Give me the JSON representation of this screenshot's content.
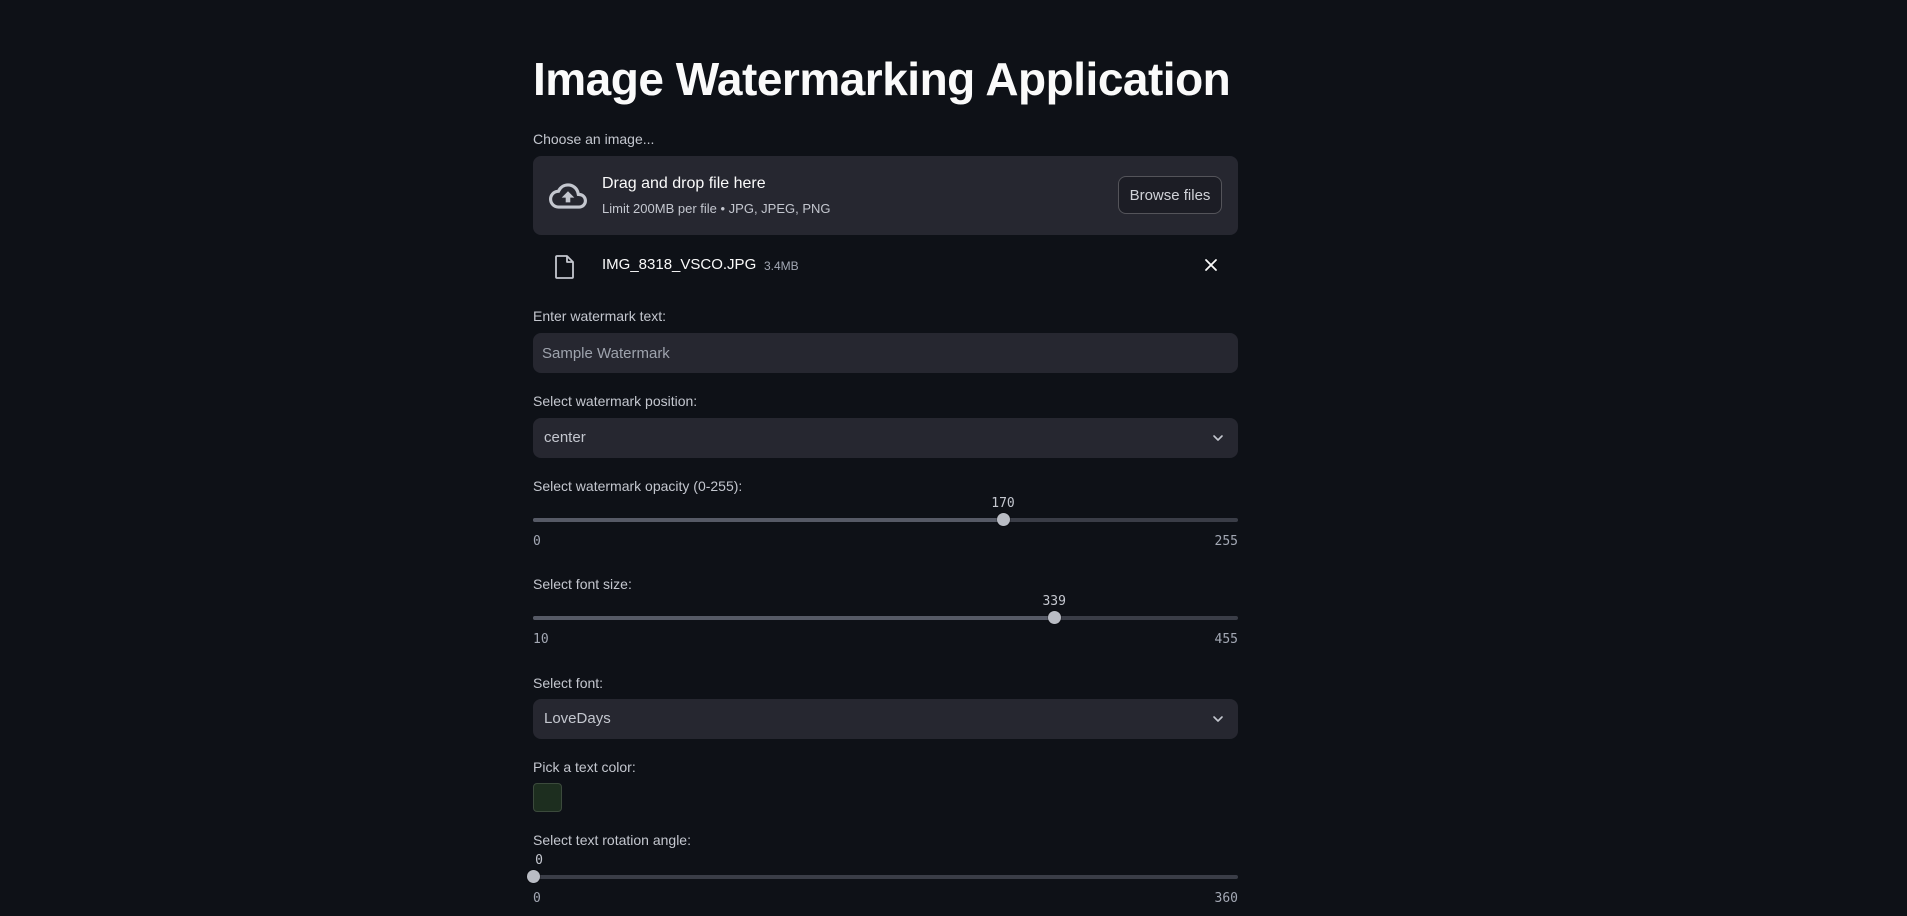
{
  "app": {
    "title": "Image Watermarking Application"
  },
  "uploader": {
    "label": "Choose an image...",
    "title": "Drag and drop file here",
    "subtitle": "Limit 200MB per file • JPG, JPEG, PNG",
    "browse_label": "Browse files",
    "upload_icon": "cloud-upload-icon"
  },
  "file": {
    "name": "IMG_8318_VSCO.JPG",
    "size": "3.4MB",
    "file_icon": "file-icon",
    "remove_icon": "close-icon"
  },
  "watermark_text": {
    "label": "Enter watermark text:",
    "value": "",
    "placeholder": "Sample Watermark"
  },
  "position": {
    "label": "Select watermark position:",
    "value": "center"
  },
  "opacity": {
    "label": "Select watermark opacity (0-255):",
    "min": "0",
    "max": "255",
    "value": "170"
  },
  "font_size": {
    "label": "Select font size:",
    "min": "10",
    "max": "455",
    "value": "339"
  },
  "font": {
    "label": "Select font:",
    "value": "LoveDays"
  },
  "text_color": {
    "label": "Pick a text color:",
    "value": "#1d2e1f"
  },
  "rotation": {
    "label": "Select text rotation angle:",
    "min": "0",
    "max": "360",
    "value": "0"
  },
  "colors": {
    "background": "#0e1117",
    "widget": "#262730",
    "text": "#fafafa"
  }
}
